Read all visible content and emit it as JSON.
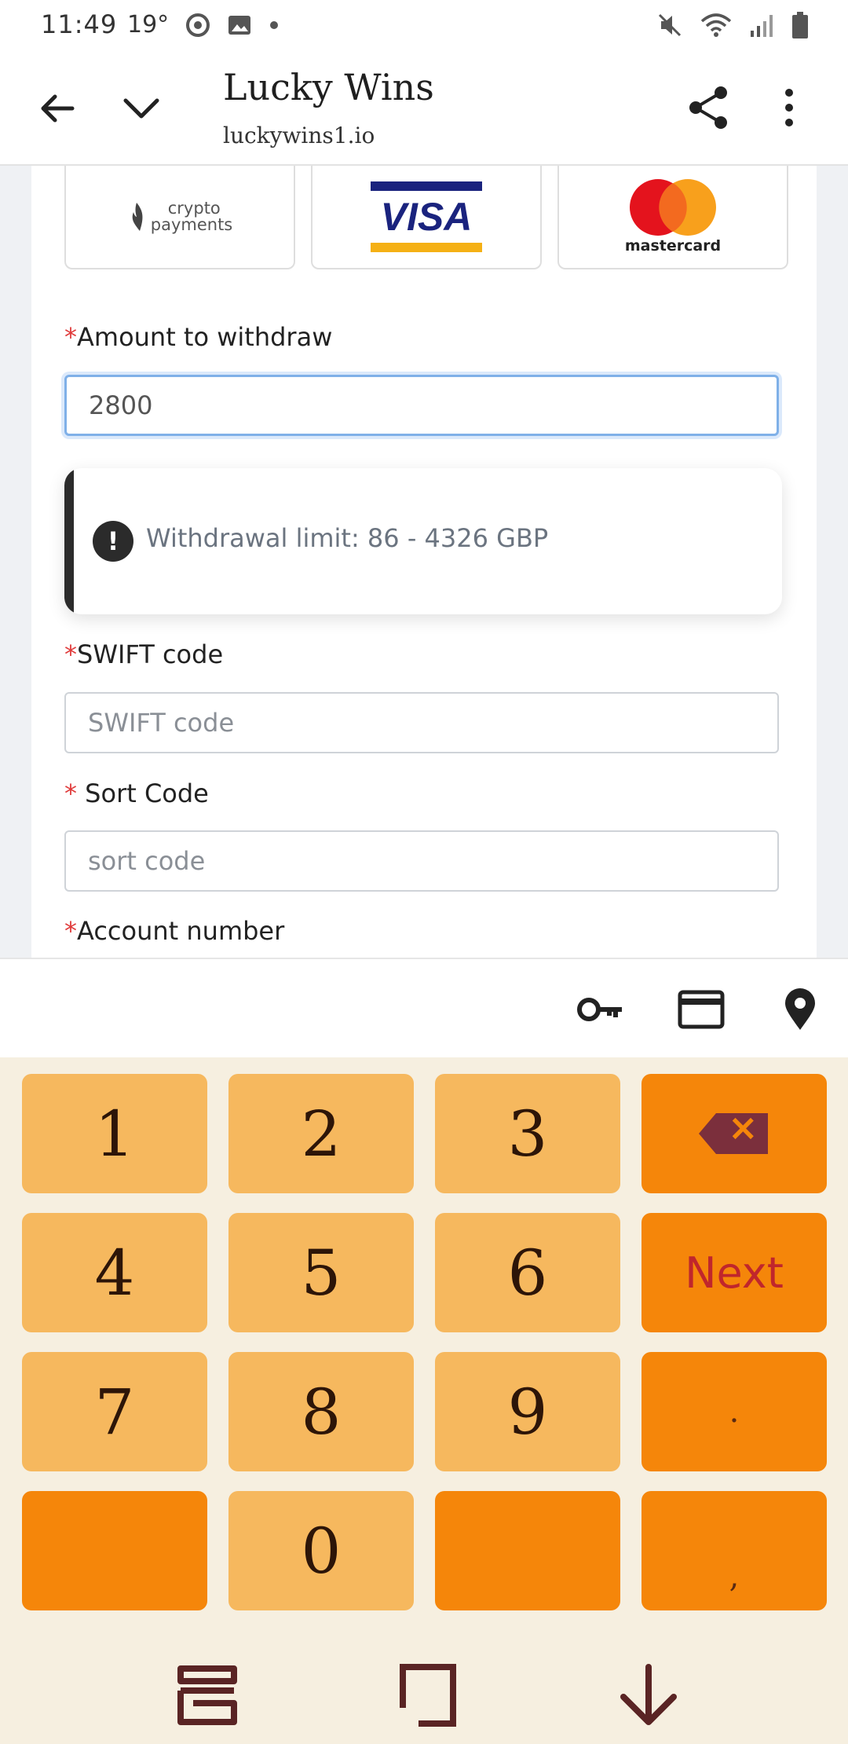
{
  "status_bar": {
    "time": "11:49",
    "temp": "19°"
  },
  "toolbar": {
    "title": "Lucky Wins",
    "url": "luckywins1.io"
  },
  "payment_methods": [
    {
      "name": "crypto payments",
      "line1": "crypto",
      "line2": "payments"
    },
    {
      "name": "VISA"
    },
    {
      "name": "mastercard"
    }
  ],
  "form": {
    "amount": {
      "label": "Amount to withdraw",
      "value": "2800"
    },
    "alert": {
      "text": "Withdrawal limit: 86 - 4326 GBP",
      "icon": "exclamation-icon"
    },
    "swift": {
      "label": "SWIFT code",
      "placeholder": "SWIFT code"
    },
    "sort": {
      "label": " Sort Code",
      "placeholder": "sort code"
    },
    "account": {
      "label": "Account number"
    },
    "required_mark": "*"
  },
  "accessory": {
    "icons": [
      "key-icon",
      "credit-card-icon",
      "location-pin-icon"
    ]
  },
  "keypad": {
    "keys": [
      "1",
      "2",
      "3",
      "",
      "4",
      "5",
      "6",
      "Next",
      "7",
      "8",
      "9",
      ".",
      "",
      "0",
      "",
      ","
    ],
    "backspace_symbol": "×"
  },
  "colors": {
    "key_light": "#f6b85e",
    "key_dark": "#f5860a",
    "keyboard_bg": "#f6efe0",
    "focus_border": "#7fb0e8",
    "required": "#e03b3b"
  }
}
